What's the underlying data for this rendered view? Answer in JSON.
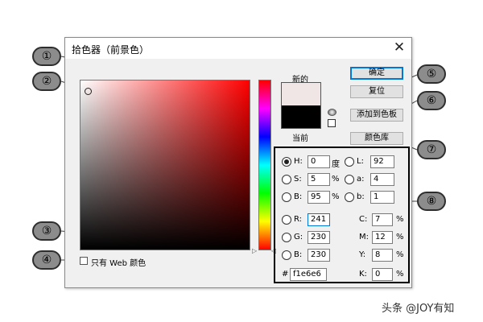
{
  "dialog": {
    "title": "拾色器（前景色）",
    "close_label": "✕"
  },
  "preview": {
    "new_label": "新的",
    "current_label": "当前",
    "new_color": "#f1e6e6",
    "current_color": "#000000"
  },
  "buttons": {
    "ok": "确定",
    "reset": "复位",
    "add_to_swatches": "添加到色板",
    "color_library": "颜色库"
  },
  "fields": {
    "H": {
      "label": "H:",
      "value": "0",
      "unit": "度"
    },
    "S": {
      "label": "S:",
      "value": "5",
      "unit": "%"
    },
    "Bv": {
      "label": "B:",
      "value": "95",
      "unit": "%"
    },
    "R": {
      "label": "R:",
      "value": "241"
    },
    "G": {
      "label": "G:",
      "value": "230"
    },
    "Bc": {
      "label": "B:",
      "value": "230"
    },
    "L": {
      "label": "L:",
      "value": "92"
    },
    "a": {
      "label": "a:",
      "value": "4"
    },
    "b": {
      "label": "b:",
      "value": "1"
    },
    "C": {
      "label": "C:",
      "value": "7",
      "unit": "%"
    },
    "M": {
      "label": "M:",
      "value": "12",
      "unit": "%"
    },
    "Y": {
      "label": "Y:",
      "value": "8",
      "unit": "%"
    },
    "K": {
      "label": "K:",
      "value": "0",
      "unit": "%"
    },
    "hex": {
      "label": "#",
      "value": "f1e6e6"
    }
  },
  "web_only_label": "只有 Web 颜色",
  "annotations": [
    "①",
    "②",
    "③",
    "④",
    "⑤",
    "⑥",
    "⑦",
    "⑧"
  ],
  "watermark": "头条 @JOY有知",
  "colors": {
    "badge_fill": "#8c8c8c",
    "ok_border": "#0078d7"
  }
}
